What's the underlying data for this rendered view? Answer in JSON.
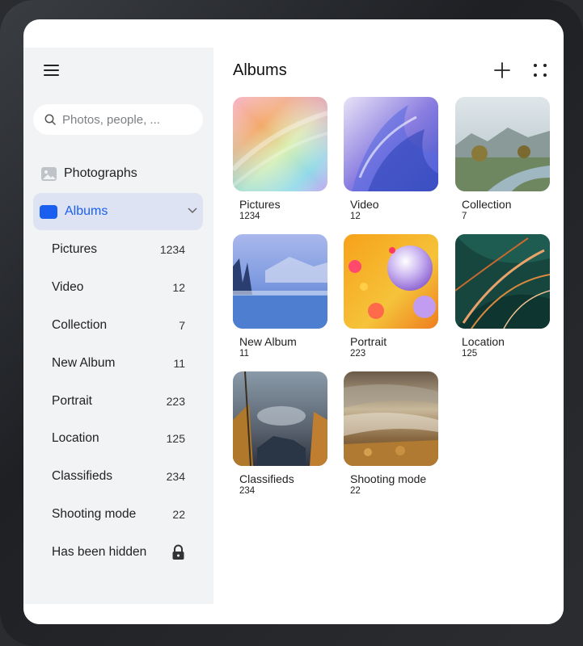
{
  "sidebar": {
    "search_placeholder": "Photos, people, ...",
    "photographs_label": "Photographs",
    "albums_label": "Albums",
    "items": [
      {
        "label": "Pictures",
        "count": "1234"
      },
      {
        "label": "Video",
        "count": "12"
      },
      {
        "label": "Collection",
        "count": "7"
      },
      {
        "label": "New Album",
        "count": "11"
      },
      {
        "label": "Portrait",
        "count": "223"
      },
      {
        "label": "Location",
        "count": "125"
      },
      {
        "label": "Classifieds",
        "count": "234"
      },
      {
        "label": "Shooting mode",
        "count": "22"
      }
    ],
    "hidden_label": "Has been hidden"
  },
  "main": {
    "title": "Albums",
    "albums": [
      {
        "name": "Pictures",
        "count": "1234"
      },
      {
        "name": "Video",
        "count": "12"
      },
      {
        "name": "Collection",
        "count": "7"
      },
      {
        "name": "New Album",
        "count": "11"
      },
      {
        "name": "Portrait",
        "count": "223"
      },
      {
        "name": "Location",
        "count": "125"
      },
      {
        "name": "Classifieds",
        "count": "234"
      },
      {
        "name": "Shooting mode",
        "count": "22"
      }
    ]
  },
  "colors": {
    "accent": "#1a5ff0",
    "sidebar_bg": "#f1f3f5",
    "selected_bg": "#dde3f3"
  },
  "icons": {
    "menu": "menu-icon",
    "search": "search-icon",
    "photos": "photo-icon",
    "albums": "folder-icon",
    "expand": "chevron-down-icon",
    "lock": "lock-icon",
    "add": "plus-icon",
    "more": "more-dots-icon"
  }
}
